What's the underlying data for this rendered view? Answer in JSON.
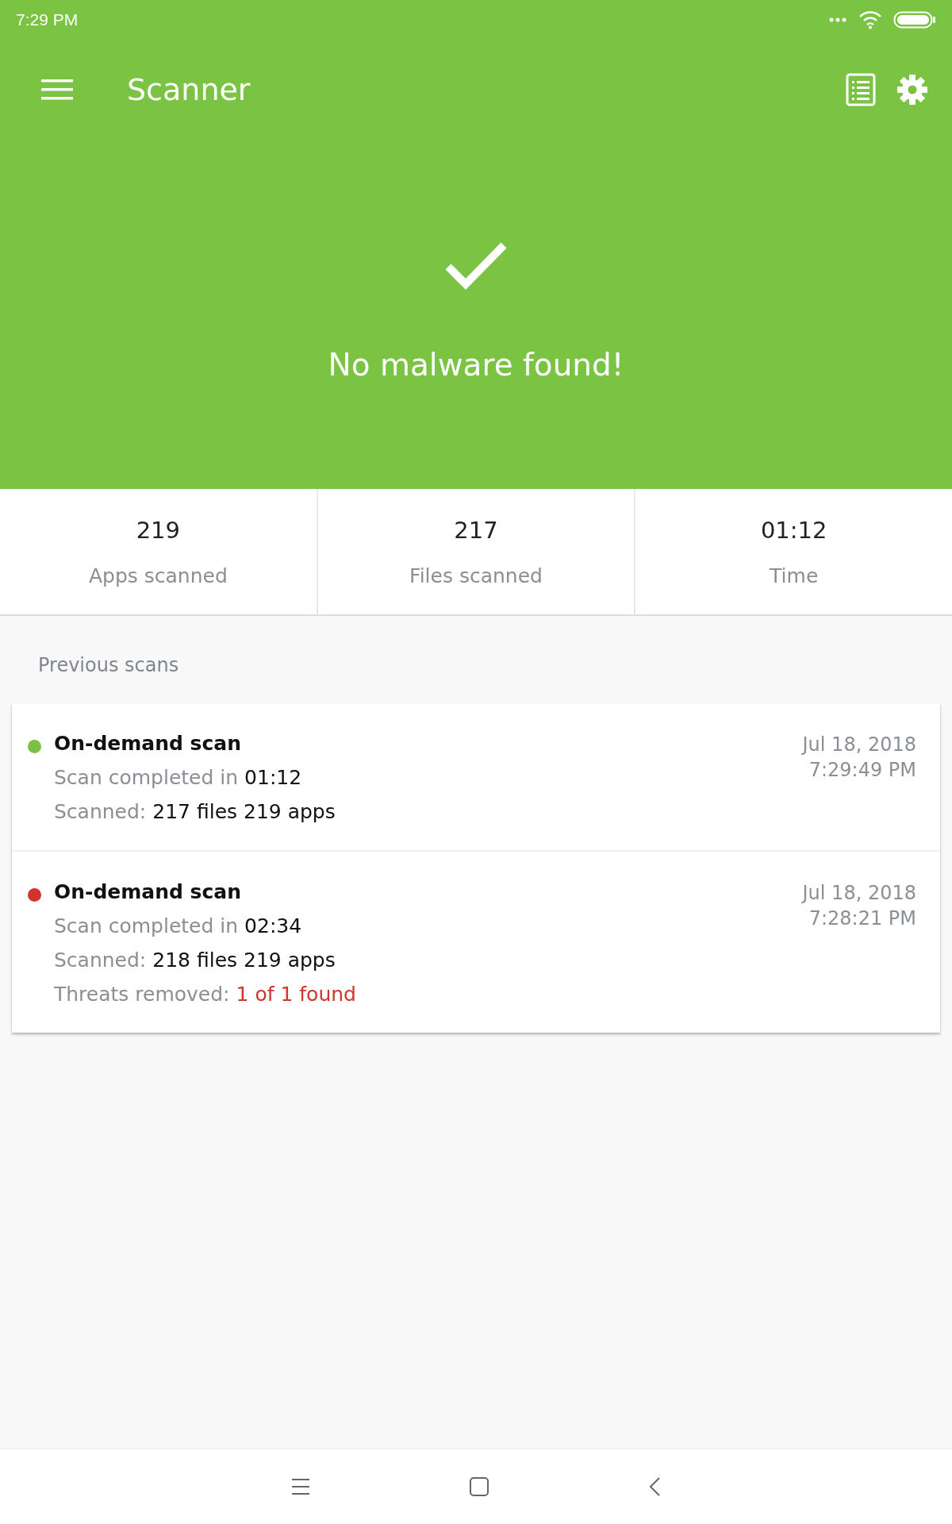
{
  "status_bar": {
    "time": "7:29 PM"
  },
  "toolbar": {
    "title": "Scanner"
  },
  "hero": {
    "message": "No malware found!"
  },
  "stats": [
    {
      "value": "219",
      "label": "Apps scanned"
    },
    {
      "value": "217",
      "label": "Files scanned"
    },
    {
      "value": "01:12",
      "label": "Time"
    }
  ],
  "previous_scans": {
    "title": "Previous scans",
    "items": [
      {
        "color": "#7ac143",
        "title": "On-demand scan",
        "lines": [
          {
            "label": "Scan completed in",
            "value": "01:12"
          },
          {
            "label": "Scanned:",
            "value": "217 files 219 apps"
          }
        ],
        "date": "Jul 18, 2018",
        "time": "7:29:49 PM"
      },
      {
        "color": "#d0342c",
        "title": "On-demand scan",
        "lines": [
          {
            "label": "Scan completed in",
            "value": "02:34"
          },
          {
            "label": "Scanned:",
            "value": "218 files 219 apps"
          },
          {
            "label": "Threats removed:",
            "value": "1 of 1 found",
            "kind": "threat"
          }
        ],
        "date": "Jul 18, 2018",
        "time": "7:28:21 PM"
      }
    ]
  }
}
